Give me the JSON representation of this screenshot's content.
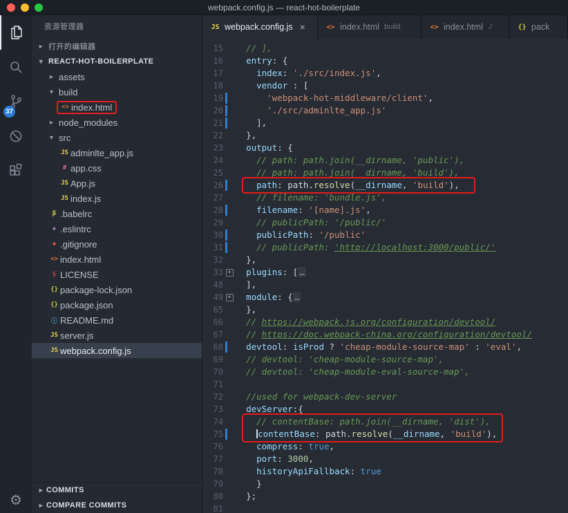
{
  "window": {
    "title": "webpack.config.js — react-hot-boilerplate"
  },
  "activity_bar": {
    "scm_badge": "37",
    "settings_glyph": "⚙"
  },
  "glyphs": {
    "chevron_right": "▸",
    "chevron_down": "▾",
    "fold_plus": "+"
  },
  "icons": {
    "js": {
      "glyph": "JS",
      "color": "#e8d44d"
    },
    "html": {
      "glyph": "<>",
      "color": "#e37933"
    },
    "css": {
      "glyph": "#",
      "color": "#cc6699"
    },
    "json": {
      "glyph": "{}",
      "color": "#cbcb41"
    },
    "babel": {
      "glyph": "β",
      "color": "#cbcb41"
    },
    "eslint": {
      "glyph": "◈",
      "color": "#b180d7"
    },
    "git": {
      "glyph": "◆",
      "color": "#e8493c"
    },
    "license": {
      "glyph": "§",
      "color": "#cc3e44"
    },
    "info": {
      "glyph": "ⓘ",
      "color": "#4aa0d5"
    }
  },
  "sidebar": {
    "title": "资源管理器",
    "rows": [
      {
        "label": "打开的编辑器",
        "chevron": "right",
        "header": true,
        "indent": 0
      },
      {
        "label": "REACT-HOT-BOILERPLATE",
        "chevron": "down",
        "header": true,
        "bold": true,
        "indent": 0
      },
      {
        "label": "assets",
        "chevron": "right",
        "indent": 1
      },
      {
        "label": "build",
        "chevron": "down",
        "indent": 1
      },
      {
        "label": "index.html",
        "icon": "html",
        "indent": 2,
        "boxed": true
      },
      {
        "label": "node_modules",
        "chevron": "right",
        "indent": 1
      },
      {
        "label": "src",
        "chevron": "down",
        "indent": 1
      },
      {
        "label": "adminlte_app.js",
        "icon": "js",
        "indent": 2
      },
      {
        "label": "app.css",
        "icon": "css",
        "indent": 2
      },
      {
        "label": "App.js",
        "icon": "js",
        "indent": 2
      },
      {
        "label": "index.js",
        "icon": "js",
        "indent": 2
      },
      {
        "label": ".babelrc",
        "icon": "babel",
        "indent": 1
      },
      {
        "label": ".eslintrc",
        "icon": "eslint",
        "indent": 1
      },
      {
        "label": ".gitignore",
        "icon": "git",
        "indent": 1
      },
      {
        "label": "index.html",
        "icon": "html",
        "indent": 1
      },
      {
        "label": "LICENSE",
        "icon": "license",
        "indent": 1
      },
      {
        "label": "package-lock.json",
        "icon": "json",
        "indent": 1
      },
      {
        "label": "package.json",
        "icon": "json",
        "indent": 1
      },
      {
        "label": "README.md",
        "icon": "info",
        "indent": 1
      },
      {
        "label": "server.js",
        "icon": "js",
        "indent": 1
      },
      {
        "label": "webpack.config.js",
        "icon": "js",
        "indent": 1,
        "selected": true
      }
    ],
    "bottom": [
      {
        "label": "COMMITS",
        "chevron": "right"
      },
      {
        "label": "COMPARE COMMITS",
        "chevron": "right"
      }
    ]
  },
  "tabs": [
    {
      "label": "webpack.config.js",
      "icon": "js",
      "active": true,
      "close": "×"
    },
    {
      "label": "index.html",
      "hint": "build",
      "icon": "html"
    },
    {
      "label": "index.html",
      "hint": "./",
      "icon": "html"
    },
    {
      "label": "pack",
      "icon": "json"
    }
  ],
  "editor": {
    "lines": [
      {
        "n": "15",
        "i": 1,
        "t": [
          [
            "c",
            "// ],"
          ]
        ]
      },
      {
        "n": "16",
        "i": 1,
        "t": [
          [
            "b",
            "entry"
          ],
          [
            "p",
            ": {"
          ]
        ]
      },
      {
        "n": "17",
        "i": 2,
        "t": [
          [
            "b",
            "index"
          ],
          [
            "p",
            ": "
          ],
          [
            "s",
            "'./src/index.js'"
          ],
          [
            "p",
            ","
          ]
        ]
      },
      {
        "n": "18",
        "i": 2,
        "t": [
          [
            "b",
            "vendor"
          ],
          [
            "p",
            " : ["
          ]
        ]
      },
      {
        "n": "19",
        "i": 3,
        "git": true,
        "t": [
          [
            "s",
            "'webpack-hot-middleware/client'"
          ],
          [
            "p",
            ","
          ]
        ]
      },
      {
        "n": "20",
        "i": 3,
        "git": true,
        "t": [
          [
            "s",
            "'./src/adminlte_app.js'"
          ]
        ]
      },
      {
        "n": "21",
        "i": 2,
        "git": true,
        "t": [
          [
            "p",
            "],"
          ]
        ]
      },
      {
        "n": "22",
        "i": 1,
        "t": [
          [
            "p",
            "},"
          ]
        ]
      },
      {
        "n": "23",
        "i": 1,
        "t": [
          [
            "b",
            "output"
          ],
          [
            "p",
            ": {"
          ]
        ]
      },
      {
        "n": "24",
        "i": 2,
        "t": [
          [
            "c",
            "// path: path.join(__dirname, 'public'),"
          ]
        ]
      },
      {
        "n": "25",
        "i": 2,
        "t": [
          [
            "c",
            "// path: path.join(__dirname, 'build'),"
          ]
        ]
      },
      {
        "n": "26",
        "i": 2,
        "git": true,
        "t": [
          [
            "b",
            "path"
          ],
          [
            "p",
            ": path."
          ],
          [
            "f",
            "resolve"
          ],
          [
            "p",
            "("
          ],
          [
            "b",
            "__dirname"
          ],
          [
            "p",
            ", "
          ],
          [
            "s",
            "'build'"
          ],
          [
            "p",
            "),"
          ]
        ]
      },
      {
        "n": "27",
        "i": 2,
        "t": [
          [
            "c",
            "// filename: 'bundle.js',"
          ]
        ]
      },
      {
        "n": "28",
        "i": 2,
        "git": true,
        "t": [
          [
            "b",
            "filename"
          ],
          [
            "p",
            ": "
          ],
          [
            "s",
            "'[name].js'"
          ],
          [
            "p",
            ","
          ]
        ]
      },
      {
        "n": "29",
        "i": 2,
        "t": [
          [
            "c",
            "// publicPath: '/public/'"
          ]
        ]
      },
      {
        "n": "30",
        "i": 2,
        "git": true,
        "t": [
          [
            "b",
            "publicPath"
          ],
          [
            "p",
            ": "
          ],
          [
            "s",
            "'/public'"
          ]
        ]
      },
      {
        "n": "31",
        "i": 2,
        "git": true,
        "t": [
          [
            "c",
            "// publicPath: "
          ],
          [
            "l",
            "'http://localhost:3000/public/'"
          ]
        ]
      },
      {
        "n": "32",
        "i": 1,
        "t": [
          [
            "p",
            "},"
          ]
        ]
      },
      {
        "n": "33",
        "i": 1,
        "fold": true,
        "t": [
          [
            "b",
            "plugins"
          ],
          [
            "p",
            ": ["
          ],
          [
            "d",
            "…"
          ]
        ]
      },
      {
        "n": "48",
        "i": 1,
        "t": [
          [
            "p",
            "],"
          ]
        ]
      },
      {
        "n": "49",
        "i": 1,
        "fold": true,
        "t": [
          [
            "b",
            "module"
          ],
          [
            "p",
            ": {"
          ],
          [
            "d",
            "…"
          ]
        ]
      },
      {
        "n": "65",
        "i": 1,
        "t": [
          [
            "p",
            "},"
          ]
        ]
      },
      {
        "n": "66",
        "i": 1,
        "t": [
          [
            "c",
            "// "
          ],
          [
            "l",
            "https://webpack.js.org/configuration/devtool/"
          ]
        ]
      },
      {
        "n": "67",
        "i": 1,
        "t": [
          [
            "c",
            "// "
          ],
          [
            "l",
            "https://doc.webpack-china.org/configuration/devtool/"
          ]
        ]
      },
      {
        "n": "68",
        "i": 1,
        "git": true,
        "t": [
          [
            "b",
            "devtool"
          ],
          [
            "p",
            ": "
          ],
          [
            "b",
            "isProd"
          ],
          [
            "p",
            " ? "
          ],
          [
            "s",
            "'cheap-module-source-map'"
          ],
          [
            "p",
            " : "
          ],
          [
            "s",
            "'eval'"
          ],
          [
            "p",
            ","
          ]
        ]
      },
      {
        "n": "69",
        "i": 1,
        "t": [
          [
            "c",
            "// devtool: 'cheap-module-source-map',"
          ]
        ]
      },
      {
        "n": "70",
        "i": 1,
        "t": [
          [
            "c",
            "// devtool: 'cheap-module-eval-source-map',"
          ]
        ]
      },
      {
        "n": "71",
        "i": 0,
        "t": []
      },
      {
        "n": "72",
        "i": 1,
        "t": [
          [
            "c",
            "//used for webpack-dev-server"
          ]
        ]
      },
      {
        "n": "73",
        "i": 1,
        "t": [
          [
            "b",
            "devServer"
          ],
          [
            "p",
            ":{"
          ]
        ]
      },
      {
        "n": "74",
        "i": 2,
        "t": [
          [
            "c",
            "// contentBase: path.join(__dirname, 'dist'),"
          ]
        ]
      },
      {
        "n": "75",
        "i": 2,
        "git": true,
        "cursor": true,
        "t": [
          [
            "b",
            "contentBase"
          ],
          [
            "p",
            ": path."
          ],
          [
            "f",
            "resolve"
          ],
          [
            "p",
            "("
          ],
          [
            "b",
            "__dirname"
          ],
          [
            "p",
            ", "
          ],
          [
            "s",
            "'build'"
          ],
          [
            "p",
            "),"
          ]
        ]
      },
      {
        "n": "76",
        "i": 2,
        "t": [
          [
            "b",
            "compress"
          ],
          [
            "p",
            ": "
          ],
          [
            "k",
            "true"
          ],
          [
            "p",
            ","
          ]
        ]
      },
      {
        "n": "77",
        "i": 2,
        "t": [
          [
            "b",
            "port"
          ],
          [
            "p",
            ": "
          ],
          [
            "num",
            "3000"
          ],
          [
            "p",
            ","
          ]
        ]
      },
      {
        "n": "78",
        "i": 2,
        "t": [
          [
            "b",
            "historyApiFallback"
          ],
          [
            "p",
            ": "
          ],
          [
            "k",
            "true"
          ]
        ]
      },
      {
        "n": "79",
        "i": 2,
        "t": [
          [
            "p",
            "}"
          ]
        ]
      },
      {
        "n": "80",
        "i": 1,
        "t": [
          [
            "p",
            "};"
          ]
        ]
      },
      {
        "n": "81",
        "i": 0,
        "t": []
      }
    ]
  }
}
